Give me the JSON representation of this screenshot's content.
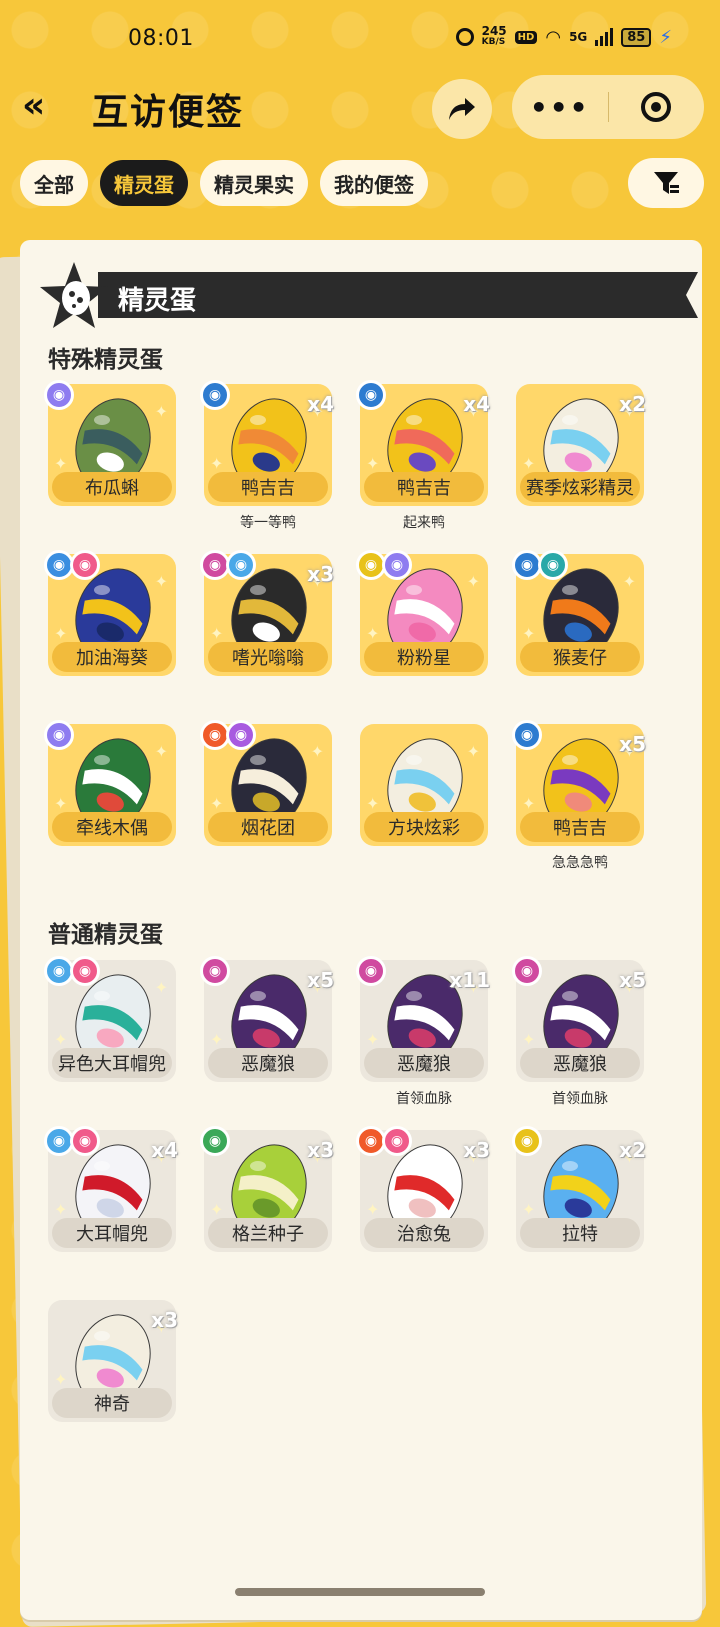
{
  "status_bar": {
    "time": "08:01",
    "speed_value": "245",
    "speed_unit": "KB/S",
    "hd": "HD",
    "network": "5G",
    "battery": "85"
  },
  "header": {
    "back_icon": "double-chevron-left",
    "title": "互访便签"
  },
  "tabs": [
    {
      "label": "全部",
      "active": false
    },
    {
      "label": "精灵蛋",
      "active": true
    },
    {
      "label": "精灵果实",
      "active": false
    },
    {
      "label": "我的便签",
      "active": false
    }
  ],
  "banner": {
    "label": "精灵蛋"
  },
  "special": {
    "title": "特殊精灵蛋",
    "items": [
      {
        "name": "布瓜蝌",
        "count": "",
        "sub": "",
        "badges": [
          "#8e7cf0"
        ],
        "egg": [
          "#6a8f46",
          "#3a5d5e",
          "#ffffff"
        ]
      },
      {
        "name": "鸭吉吉",
        "count": "x4",
        "sub": "等一等鸭",
        "badges": [
          "#2d7bd0"
        ],
        "egg": [
          "#f2c21a",
          "#f08a36",
          "#2a3a8a"
        ]
      },
      {
        "name": "鸭吉吉",
        "count": "x4",
        "sub": "起来鸭",
        "badges": [
          "#2d7bd0"
        ],
        "egg": [
          "#f2c21a",
          "#f06a5a",
          "#6a4ac0"
        ]
      },
      {
        "name": "赛季炫彩精灵",
        "count": "x2",
        "sub": "",
        "badges": [],
        "egg": [
          "#f3eee0",
          "#7ad0f0",
          "#f08ad0"
        ]
      },
      {
        "name": "加油海葵",
        "count": "",
        "sub": "",
        "badges": [
          "#3a8ee0",
          "#f05a8a"
        ],
        "egg": [
          "#2a3a9a",
          "#f2c21a",
          "#1a2a6a"
        ]
      },
      {
        "name": "嗜光嗡嗡",
        "count": "x3",
        "sub": "",
        "badges": [
          "#d04aa0",
          "#4aa8e8"
        ],
        "egg": [
          "#2a2a2a",
          "#e2b83a",
          "#ffffff"
        ]
      },
      {
        "name": "粉粉星",
        "count": "",
        "sub": "",
        "badges": [
          "#e8c21a",
          "#8e7cf0"
        ],
        "egg": [
          "#f48ac0",
          "#ffffff",
          "#f06aa8"
        ]
      },
      {
        "name": "猴麦仔",
        "count": "",
        "sub": "",
        "badges": [
          "#2d7bd0",
          "#2aa8a8"
        ],
        "egg": [
          "#2a2a3a",
          "#f07a1a",
          "#2a6ac0"
        ]
      },
      {
        "name": "牵线木偶",
        "count": "",
        "sub": "",
        "badges": [
          "#8e7cf0"
        ],
        "egg": [
          "#2a7a3a",
          "#ffffff",
          "#e04a3a"
        ]
      },
      {
        "name": "烟花团",
        "count": "",
        "sub": "",
        "badges": [
          "#f05a2a",
          "#a85ae0"
        ],
        "egg": [
          "#2a2a3a",
          "#f6eedc",
          "#c8a82a"
        ]
      },
      {
        "name": "方块炫彩",
        "count": "",
        "sub": "",
        "badges": [],
        "egg": [
          "#f3eee0",
          "#7ad0f0",
          "#f0c23a"
        ]
      },
      {
        "name": "鸭吉吉",
        "count": "x5",
        "sub": "急急急鸭",
        "badges": [
          "#2d7bd0"
        ],
        "egg": [
          "#f2c21a",
          "#7a3ac0",
          "#f08a7a"
        ]
      }
    ]
  },
  "normal": {
    "title": "普通精灵蛋",
    "items": [
      {
        "name": "异色大耳帽兜",
        "count": "",
        "sub": "",
        "badges": [
          "#4aa8e8",
          "#f05a8a"
        ],
        "egg": [
          "#e8eef0",
          "#2ab09a",
          "#f8a8c0"
        ]
      },
      {
        "name": "恶魔狼",
        "count": "x5",
        "sub": "",
        "badges": [
          "#d04aa0"
        ],
        "egg": [
          "#4a2a6a",
          "#ffffff",
          "#c83a6a"
        ]
      },
      {
        "name": "恶魔狼",
        "count": "x11",
        "sub": "首领血脉",
        "badges": [
          "#d04aa0"
        ],
        "egg": [
          "#4a2a6a",
          "#ffffff",
          "#c83a6a"
        ]
      },
      {
        "name": "恶魔狼",
        "count": "x5",
        "sub": "首领血脉",
        "badges": [
          "#d04aa0"
        ],
        "egg": [
          "#4a2a6a",
          "#ffffff",
          "#c83a6a"
        ]
      },
      {
        "name": "大耳帽兜",
        "count": "x4",
        "sub": "",
        "badges": [
          "#4aa8e8",
          "#f05a8a"
        ],
        "egg": [
          "#f4f4f8",
          "#d01a2a",
          "#cfd6e8"
        ]
      },
      {
        "name": "格兰种子",
        "count": "x3",
        "sub": "",
        "badges": [
          "#3aa858"
        ],
        "egg": [
          "#a8d03a",
          "#f4f0c8",
          "#6a9a2a"
        ]
      },
      {
        "name": "治愈兔",
        "count": "x3",
        "sub": "",
        "badges": [
          "#f05a2a",
          "#f05a8a"
        ],
        "egg": [
          "#ffffff",
          "#e02a2a",
          "#f0c0c0"
        ]
      },
      {
        "name": "拉特",
        "count": "x2",
        "sub": "",
        "badges": [
          "#e8c21a"
        ],
        "egg": [
          "#5ab0f0",
          "#f2d21a",
          "#2a3a9a"
        ]
      },
      {
        "name": "神奇",
        "count": "x3",
        "sub": "",
        "badges": [],
        "egg": [
          "#f3eee0",
          "#7ad0f0",
          "#f08ad0"
        ]
      }
    ]
  }
}
